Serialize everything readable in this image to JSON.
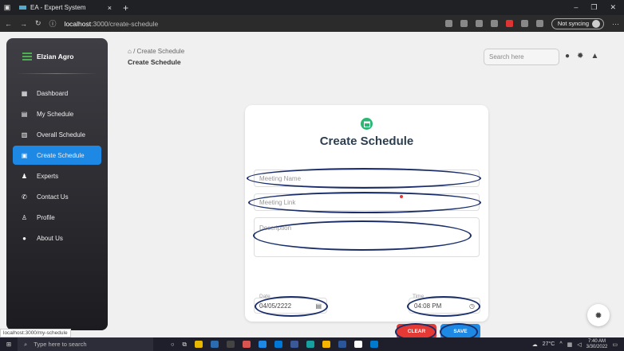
{
  "browser": {
    "tab_title": "EA - Expert System",
    "tab_close": "×",
    "new_tab": "+",
    "url_host": "localhost",
    "url_rest": ":3000/create-schedule",
    "sync_label": "Not syncing",
    "more": "···"
  },
  "sidebar": {
    "brand": "Elzian Agro",
    "items": [
      {
        "label": "Dashboard",
        "icon": "dashboard-icon",
        "active": false
      },
      {
        "label": "My Schedule",
        "icon": "schedule-icon",
        "active": false
      },
      {
        "label": "Overall Schedule",
        "icon": "overall-schedule-icon",
        "active": false
      },
      {
        "label": "Create Schedule",
        "icon": "calendar-icon",
        "active": true
      },
      {
        "label": "Experts",
        "icon": "people-icon",
        "active": false
      },
      {
        "label": "Contact Us",
        "icon": "phone-icon",
        "active": false
      },
      {
        "label": "Profile",
        "icon": "person-icon",
        "active": false
      },
      {
        "label": "About Us",
        "icon": "info-icon",
        "active": false
      }
    ]
  },
  "header": {
    "breadcrumb_sep": "/",
    "breadcrumb_current": "Create Schedule",
    "title": "Create Schedule",
    "search_placeholder": "Search here"
  },
  "form": {
    "title": "Create Schedule",
    "meeting_name_placeholder": "Meeting Name",
    "meeting_link_placeholder": "Meeting Link",
    "description_placeholder": "Description",
    "date_label": "Date",
    "date_value": "04/05/2222",
    "time_label": "Time",
    "time_value": "04:08 PM",
    "clear_label": "CLEAR",
    "save_label": "SAVE"
  },
  "status_url": "localhost:3000/my-schedule",
  "taskbar": {
    "search_placeholder": "Type here to search",
    "temperature": "27°C",
    "time": "7:40 AM",
    "date": "3/30/2022"
  },
  "colors": {
    "accent": "#1e88e5",
    "danger": "#e53935",
    "success": "#2bb673",
    "annotation": "#1a2e6a"
  }
}
